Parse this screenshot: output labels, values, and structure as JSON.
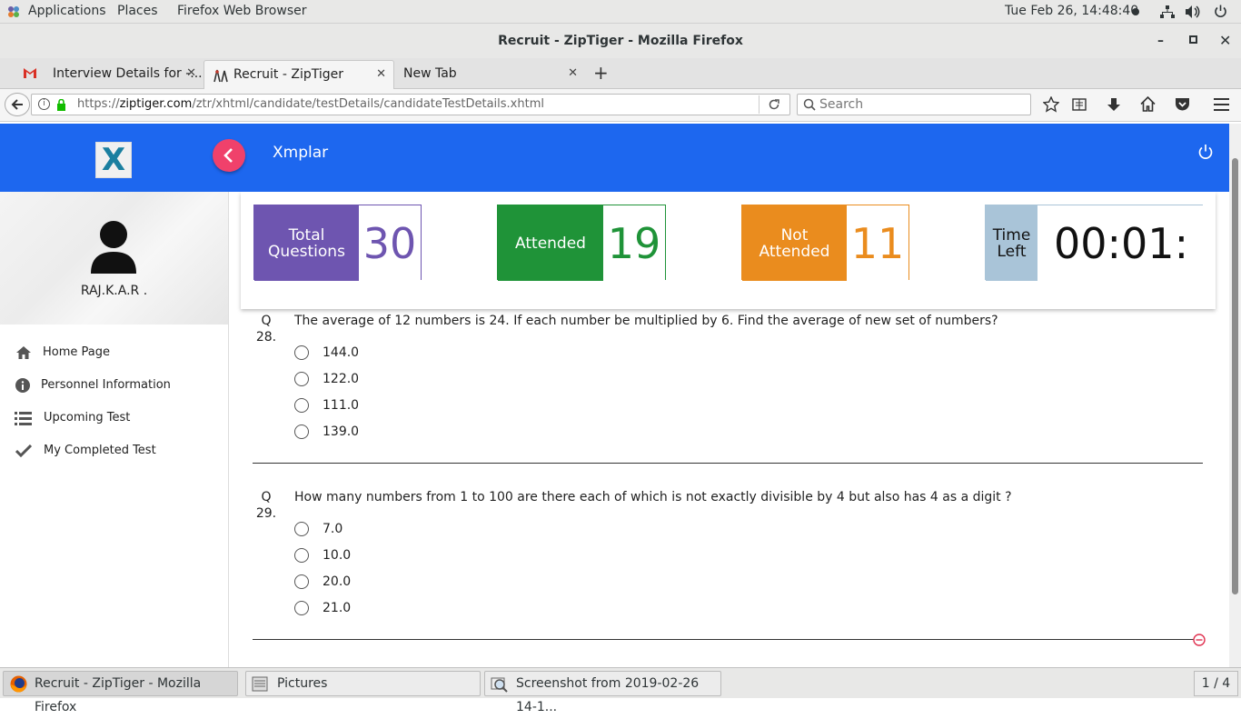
{
  "topbar": {
    "applications": "Applications",
    "places": "Places",
    "browser": "Firefox Web Browser",
    "clock": "Tue Feb 26, 14:48:40"
  },
  "window": {
    "title": "Recruit - ZipTiger - Mozilla Firefox"
  },
  "tabs": [
    {
      "label": "Interview Details for -..."
    },
    {
      "label": "Recruit - ZipTiger"
    },
    {
      "label": "New Tab"
    }
  ],
  "nav": {
    "url_prefix": "https://",
    "url_domain": "ziptiger.com",
    "url_path": "/ztr/xhtml/candidate/testDetails/candidateTestDetails.xhtml",
    "search_placeholder": "Search"
  },
  "header": {
    "brand": "Xmplar",
    "logo_letter": "X"
  },
  "profile": {
    "name": "RAJ.K.A.R ."
  },
  "sidebar": {
    "items": [
      {
        "label": "Home Page",
        "icon": "home-icon"
      },
      {
        "label": "Personnel Information",
        "icon": "info-icon"
      },
      {
        "label": "Upcoming Test",
        "icon": "list-icon"
      },
      {
        "label": "My Completed Test",
        "icon": "check-icon"
      }
    ]
  },
  "stats": {
    "total": {
      "label1": "Total",
      "label2": "Questions",
      "value": "30",
      "color": "#6e55b0"
    },
    "attended": {
      "label": "Attended",
      "value": "19",
      "color": "#1f9338"
    },
    "not_attended": {
      "label1": "Not",
      "label2": "Attended",
      "value": "11",
      "color": "#ea8c1e"
    },
    "time": {
      "label1": "Time",
      "label2": "Left",
      "value": "00:01:",
      "color": "#a9c4d8"
    }
  },
  "questions": [
    {
      "q": "Q",
      "number": "28.",
      "text": "The average of 12 numbers is 24. If each number be multiplied by 6. Find the average of new set of numbers?",
      "options": [
        "144.0",
        "122.0",
        "111.0",
        "139.0"
      ]
    },
    {
      "q": "Q",
      "number": "29.",
      "text": "How many numbers from 1 to 100 are there each of which is not exactly divisible by 4 but also has 4 as a digit ?",
      "options": [
        "7.0",
        "10.0",
        "20.0",
        "21.0"
      ]
    }
  ],
  "taskbar": {
    "items": [
      {
        "label": "Recruit - ZipTiger - Mozilla Firefox"
      },
      {
        "label": "Pictures"
      },
      {
        "label": "Screenshot from 2019-02-26 14-1..."
      }
    ],
    "workspace": "1 / 4"
  }
}
